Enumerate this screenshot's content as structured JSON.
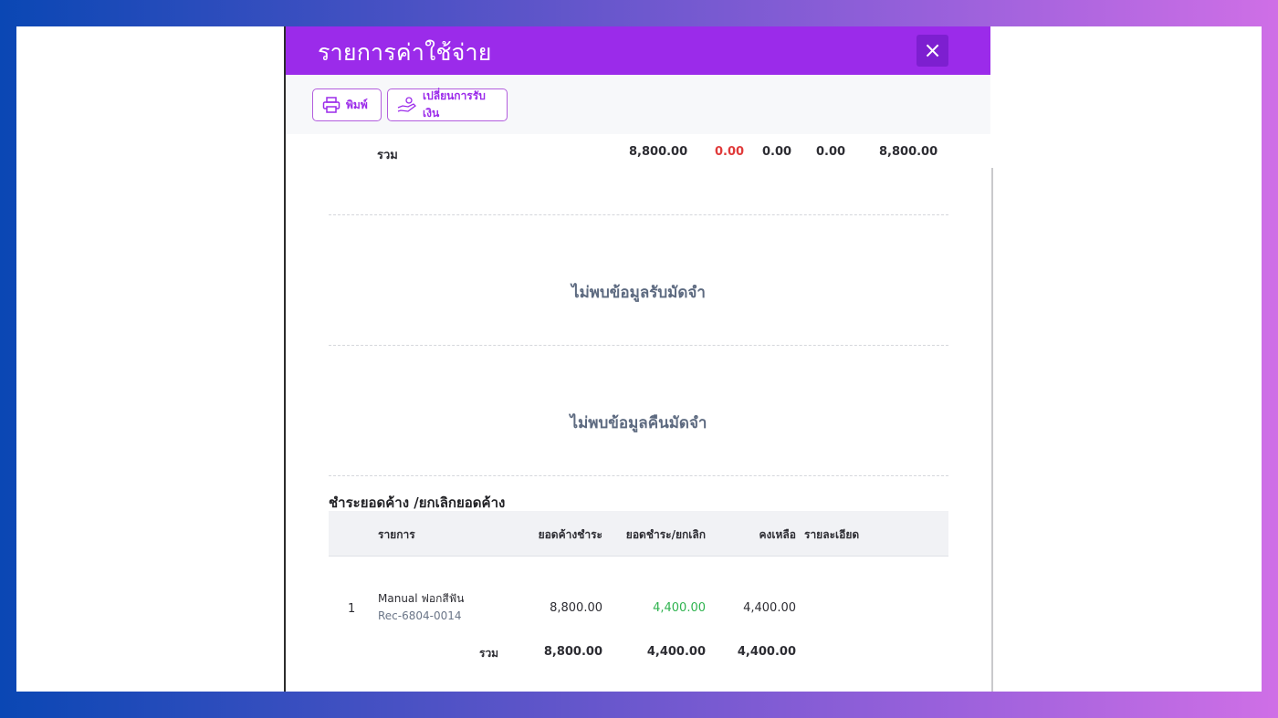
{
  "modal": {
    "title": "รายการค่าใช้จ่าย",
    "close_label": "×"
  },
  "toolbar": {
    "print_label": "พิมพ์",
    "change_payment_label": "เปลี่ยนการรับเงิน"
  },
  "summary_row": {
    "label": "รวม",
    "values": [
      "8,800.00",
      "0.00",
      "0.00",
      "0.00",
      "8,800.00"
    ]
  },
  "empty_messages": {
    "deposit_received": "ไม่พบข้อมูลรับมัดจำ",
    "deposit_returned": "ไม่พบข้อมูลคืนมัดจำ"
  },
  "outstanding_section": {
    "title": "ชำระยอดค้าง /ยกเลิกยอดค้าง",
    "columns": [
      "รายการ",
      "ยอดค้างชำระ",
      "ยอดชำระ/ยกเลิก",
      "คงเหลือ",
      "รายละเอียด"
    ],
    "rows": [
      {
        "index": "1",
        "item_name": "Manual ฟอกสีฟัน",
        "receipt_no": "Rec-6804-0014",
        "outstanding": "8,800.00",
        "paid_cancelled": "4,400.00",
        "remaining": "4,400.00",
        "detail": ""
      }
    ],
    "total": {
      "label": "รวม",
      "outstanding": "8,800.00",
      "paid_cancelled": "4,400.00",
      "remaining": "4,400.00"
    }
  },
  "colors": {
    "header_bg": "#9b2bea",
    "close_bg": "#7d1fd0",
    "accent": "#9b2bea",
    "negative_red": "#e03a3a",
    "positive_green": "#2fb34f"
  }
}
